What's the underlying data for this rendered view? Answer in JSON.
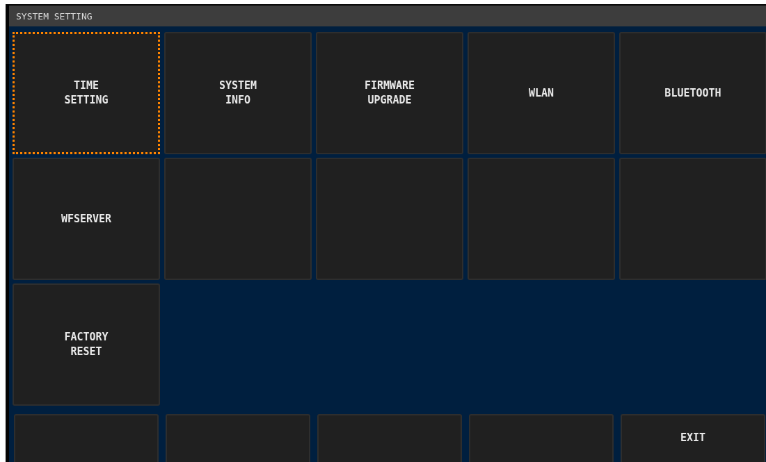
{
  "window": {
    "title": "SYSTEM SETTING"
  },
  "tiles": [
    {
      "kind": "label",
      "label": "TIME\nSETTING",
      "selected": true
    },
    {
      "kind": "label",
      "label": "SYSTEM\nINFO",
      "selected": false
    },
    {
      "kind": "label",
      "label": "FIRMWARE\nUPGRADE",
      "selected": false
    },
    {
      "kind": "label",
      "label": "WLAN",
      "selected": false
    },
    {
      "kind": "label",
      "label": "BLUETOOTH",
      "selected": false
    },
    {
      "kind": "label",
      "label": "WFSERVER",
      "selected": false
    },
    {
      "kind": "empty",
      "selected": false
    },
    {
      "kind": "empty",
      "selected": false
    },
    {
      "kind": "empty",
      "selected": false
    },
    {
      "kind": "empty",
      "selected": false
    },
    {
      "kind": "label",
      "label": "FACTORY\nRESET",
      "selected": false
    }
  ],
  "bottom_bar": [
    {
      "kind": "empty"
    },
    {
      "kind": "empty"
    },
    {
      "kind": "empty"
    },
    {
      "kind": "empty"
    },
    {
      "kind": "label",
      "label": "EXIT"
    }
  ]
}
